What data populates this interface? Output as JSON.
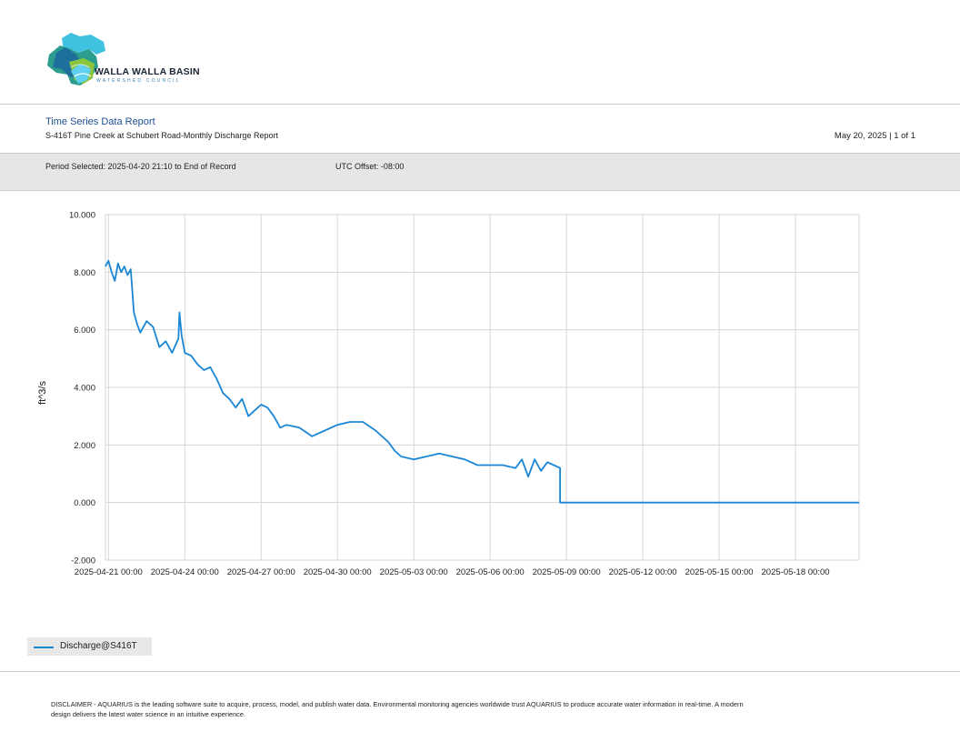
{
  "brand": {
    "name": "WALLA WALLA BASIN",
    "subtitle": "WATERSHED COUNCIL"
  },
  "report": {
    "title": "Time Series Data Report",
    "subtitle": "S-416T Pine Creek at Schubert Road-Monthly Discharge Report",
    "date_page": "May 20, 2025 | 1 of 1",
    "period": "Period Selected: 2025-04-20 21:10 to End of Record",
    "utc_offset": "UTC Offset: -08:00"
  },
  "colors": {
    "series": "#1a86d6",
    "title": "#1f4e92",
    "grid": "#d6d6d6"
  },
  "chart_data": {
    "type": "line",
    "ylabel": "ft^3/s",
    "xlabel": "",
    "ylim": [
      -2,
      10
    ],
    "xlim": [
      "2025-04-20 21:10",
      "2025-05-20 12:00"
    ],
    "y_ticks": [
      "10.000",
      "8.000",
      "6.000",
      "4.000",
      "2.000",
      "0.000",
      "-2.000"
    ],
    "x_ticks": [
      "2025-04-21 00:00",
      "2025-04-24 00:00",
      "2025-04-27 00:00",
      "2025-04-30 00:00",
      "2025-05-03 00:00",
      "2025-05-06 00:00",
      "2025-05-09 00:00",
      "2025-05-12 00:00",
      "2025-05-15 00:00",
      "2025-05-18 00:00"
    ],
    "grid": true,
    "legend": "bottom-left",
    "series": [
      {
        "name": "Discharge@S416T",
        "color": "#1a86d6",
        "x": [
          "2025-04-20 21:10",
          "2025-04-21 00:00",
          "2025-04-21 03:00",
          "2025-04-21 06:00",
          "2025-04-21 09:00",
          "2025-04-21 12:00",
          "2025-04-21 15:00",
          "2025-04-21 18:00",
          "2025-04-21 21:00",
          "2025-04-22 00:00",
          "2025-04-22 03:00",
          "2025-04-22 06:00",
          "2025-04-22 12:00",
          "2025-04-22 18:00",
          "2025-04-23 00:00",
          "2025-04-23 06:00",
          "2025-04-23 12:00",
          "2025-04-23 18:00",
          "2025-04-23 19:00",
          "2025-04-23 21:00",
          "2025-04-24 00:00",
          "2025-04-24 06:00",
          "2025-04-24 12:00",
          "2025-04-24 18:00",
          "2025-04-25 00:00",
          "2025-04-25 06:00",
          "2025-04-25 12:00",
          "2025-04-25 18:00",
          "2025-04-26 00:00",
          "2025-04-26 06:00",
          "2025-04-26 12:00",
          "2025-04-26 18:00",
          "2025-04-27 00:00",
          "2025-04-27 06:00",
          "2025-04-27 12:00",
          "2025-04-27 18:00",
          "2025-04-28 00:00",
          "2025-04-28 12:00",
          "2025-04-29 00:00",
          "2025-04-29 12:00",
          "2025-04-30 00:00",
          "2025-04-30 12:00",
          "2025-05-01 00:00",
          "2025-05-01 12:00",
          "2025-05-02 00:00",
          "2025-05-02 06:00",
          "2025-05-02 12:00",
          "2025-05-03 00:00",
          "2025-05-03 12:00",
          "2025-05-04 00:00",
          "2025-05-04 12:00",
          "2025-05-05 00:00",
          "2025-05-05 12:00",
          "2025-05-06 00:00",
          "2025-05-06 12:00",
          "2025-05-07 00:00",
          "2025-05-07 06:00",
          "2025-05-07 12:00",
          "2025-05-07 18:00",
          "2025-05-08 00:00",
          "2025-05-08 06:00",
          "2025-05-08 12:00",
          "2025-05-08 18:00",
          "2025-05-08 18:01",
          "2025-05-20 12:00"
        ],
        "y": [
          8.2,
          8.4,
          8.0,
          7.7,
          8.3,
          8.0,
          8.2,
          7.9,
          8.1,
          6.6,
          6.2,
          5.9,
          6.3,
          6.1,
          5.4,
          5.6,
          5.2,
          5.7,
          6.6,
          5.8,
          5.2,
          5.1,
          4.8,
          4.6,
          4.7,
          4.3,
          3.8,
          3.6,
          3.3,
          3.6,
          3.0,
          3.2,
          3.4,
          3.3,
          3.0,
          2.6,
          2.7,
          2.6,
          2.3,
          2.5,
          2.7,
          2.8,
          2.8,
          2.5,
          2.1,
          1.8,
          1.6,
          1.5,
          1.6,
          1.7,
          1.6,
          1.5,
          1.3,
          1.3,
          1.3,
          1.2,
          1.5,
          0.9,
          1.5,
          1.1,
          1.4,
          1.3,
          1.2,
          0.0,
          0.0
        ]
      }
    ]
  },
  "disclaimer": "DISCLAIMER - AQUARIUS is the leading software suite to acquire, process, model, and publish water data. Environmental monitoring agencies worldwide trust AQUARIUS to produce accurate water information in real-time. A modern design delivers the latest water science in an intuitive experience."
}
